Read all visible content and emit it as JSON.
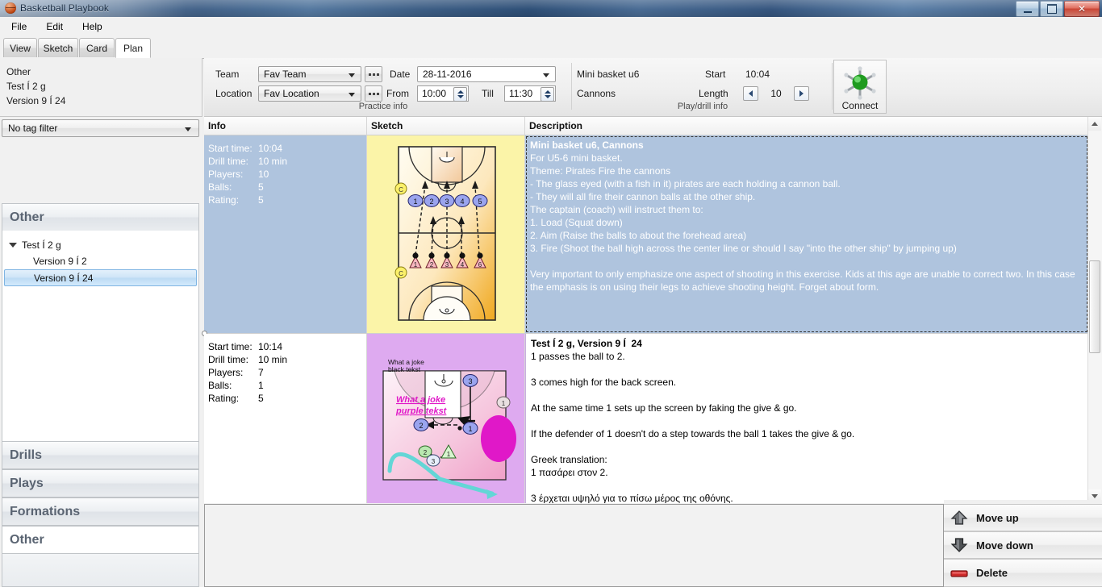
{
  "window": {
    "title": "Basketball Playbook",
    "icon": "basketball-icon",
    "controls": {
      "minimize": "Minimize",
      "maximize": "Maximize",
      "close": "✕"
    }
  },
  "menubar": {
    "items": [
      "File",
      "Edit",
      "Help"
    ]
  },
  "tabs": {
    "items": [
      {
        "label": "View",
        "active": false
      },
      {
        "label": "Sketch",
        "active": false
      },
      {
        "label": "Card",
        "active": false
      },
      {
        "label": "Plan",
        "active": true
      }
    ]
  },
  "sidebar": {
    "header_lines": [
      "Other",
      "Test Í 2 g",
      "Version 9 Í  24"
    ],
    "tag_filter": {
      "value": "No tag filter"
    },
    "group_title": "Other",
    "tree": [
      {
        "label": "Test Í 2 g",
        "level": 0,
        "expanded": true,
        "selected": false
      },
      {
        "label": "Version 9 Í  2",
        "level": 1,
        "expanded": false,
        "selected": false
      },
      {
        "label": "Version 9 Í  24",
        "level": 1,
        "expanded": false,
        "selected": true
      }
    ],
    "sections": [
      {
        "label": "Drills",
        "active": false
      },
      {
        "label": "Plays",
        "active": false
      },
      {
        "label": "Formations",
        "active": false
      },
      {
        "label": "Other",
        "active": true
      }
    ]
  },
  "ribbon": {
    "practice": {
      "group_label": "Practice info",
      "team_label": "Team",
      "team_value": "Fav Team",
      "location_label": "Location",
      "location_value": "Fav Location",
      "date_label": "Date",
      "date_value": "28-11-2016",
      "from_label": "From",
      "from_value": "10:00",
      "till_label": "Till",
      "till_value": "11:30",
      "browse_button": "…"
    },
    "playdrill": {
      "group_label": "Play/drill info",
      "name_line1": "Mini basket u6",
      "name_line2": "Cannons",
      "start_label": "Start",
      "start_value": "10:04",
      "length_label": "Length",
      "length_value": "10"
    },
    "connect": {
      "label": "Connect",
      "icon": "network-connect-icon"
    }
  },
  "grid": {
    "headers": [
      "Info",
      "Sketch",
      "Description"
    ],
    "rows": [
      {
        "selected": true,
        "info": [
          {
            "key": "Start time:",
            "value": "10:04"
          },
          {
            "key": "Drill time:",
            "value": "10 min"
          },
          {
            "key": "Players:",
            "value": "10"
          },
          {
            "key": "Balls:",
            "value": "5"
          },
          {
            "key": "Rating:",
            "value": "5"
          }
        ],
        "sketch": "fullcourt-cannons-sketch",
        "description": [
          {
            "text": "Mini basket u6, Cannons",
            "bold": true
          },
          {
            "text": "For U5-6 mini basket.",
            "bold": false
          },
          {
            "text": "Theme: Pirates Fire the cannons",
            "bold": false
          },
          {
            "text": "- The glass eyed (with a fish in it) pirates are each holding a cannon ball.",
            "bold": false
          },
          {
            "text": "- They will all fire their cannon balls at the other ship.",
            "bold": false
          },
          {
            "text": "The captain (coach) will instruct them to:",
            "bold": false
          },
          {
            "text": "1. Load (Squat down)",
            "bold": false
          },
          {
            "text": "2. Aim (Raise the balls to about the forehead area)",
            "bold": false
          },
          {
            "text": "3. Fire (Shoot the ball high across the center line or should I say \"into the other ship\" by jumping up)",
            "bold": false
          },
          {
            "text": " ",
            "bold": false
          },
          {
            "text": "Very important to only emphasize one aspect of shooting in this exercise. Kids at this age are unable to correct two. In this case",
            "bold": false
          },
          {
            "text": "the emphasis is on using their legs to achieve shooting height. Forget about form.",
            "bold": false
          }
        ]
      },
      {
        "selected": false,
        "info": [
          {
            "key": "Start time:",
            "value": "10:14"
          },
          {
            "key": "Drill time:",
            "value": "10 min"
          },
          {
            "key": "Players:",
            "value": "7"
          },
          {
            "key": "Balls:",
            "value": "1"
          },
          {
            "key": "Rating:",
            "value": "5"
          }
        ],
        "sketch": "halfcourt-screen-sketch",
        "sketch_annotations": {
          "black_text": "What a joke\nblack tekst",
          "purple_text": "What a joke\npurple tekst"
        },
        "description": [
          {
            "text": "Test Í 2 g, Version 9 Í  24",
            "bold": true
          },
          {
            "text": "1 passes the ball to 2.",
            "bold": false
          },
          {
            "text": " ",
            "bold": false
          },
          {
            "text": "3 comes high for the back screen.",
            "bold": false
          },
          {
            "text": " ",
            "bold": false
          },
          {
            "text": "At the same time 1 sets up the screen by faking the give & go.",
            "bold": false
          },
          {
            "text": " ",
            "bold": false
          },
          {
            "text": "If the defender of 1 doesn't do a step towards the ball 1 takes the give & go.",
            "bold": false
          },
          {
            "text": " ",
            "bold": false
          },
          {
            "text": "Greek translation:",
            "bold": false
          },
          {
            "text": "1 πασάρει στον 2.",
            "bold": false
          },
          {
            "text": " ",
            "bold": false
          },
          {
            "text": "3 έρχεται υψηλό για το πίσω μέρος της οθόνης.",
            "bold": false
          }
        ]
      }
    ]
  },
  "actions": {
    "items": [
      {
        "label": "Move up",
        "icon": "arrow-up-icon"
      },
      {
        "label": "Move down",
        "icon": "arrow-down-icon"
      },
      {
        "label": "Delete",
        "icon": "delete-bar-icon"
      }
    ]
  },
  "colors": {
    "title_blue": "#3c5d85",
    "selection_blue": "#afc4de",
    "tree_select": "#cde4f7",
    "sketch1_bg": "#fbf4a8",
    "sketch2_bg": "#deaaf0",
    "accent_magenta": "#e018c8",
    "accent_cyan": "#63d6d6"
  }
}
